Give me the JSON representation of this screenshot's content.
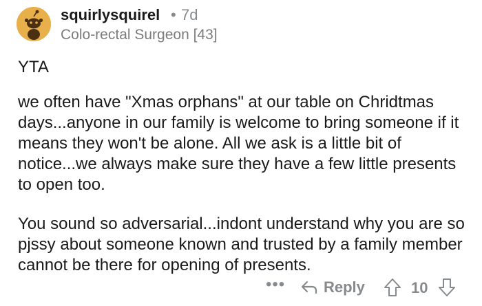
{
  "comment": {
    "username": "squirlysquirel",
    "separator": "•",
    "age": "7d",
    "flair": "Colo-rectal Surgeon [43]",
    "avatar_icon": "snoo-avatar-icon",
    "paragraphs": [
      "YTA",
      "we often have \"Xmas orphans\" at our table on Chridtmas days...anyone in our family is welcome to bring someone if it means they won't be alone. All we ask is a little bit of notice...we always make sure they have a few little presents to open too.",
      "You sound so adversarial...indont understand why you are so pjssy about someone known and trusted by a family member cannot be there for opening of presents."
    ]
  },
  "actions": {
    "more_label": "•••",
    "reply_label": "Reply",
    "score": "10",
    "upvote_icon": "upvote-arrow-icon",
    "downvote_icon": "downvote-arrow-icon",
    "reply_icon": "reply-arrow-icon"
  },
  "colors": {
    "text": "#1a1a1b",
    "meta": "#878a8c",
    "avatar_bg": "#e8b04a"
  }
}
